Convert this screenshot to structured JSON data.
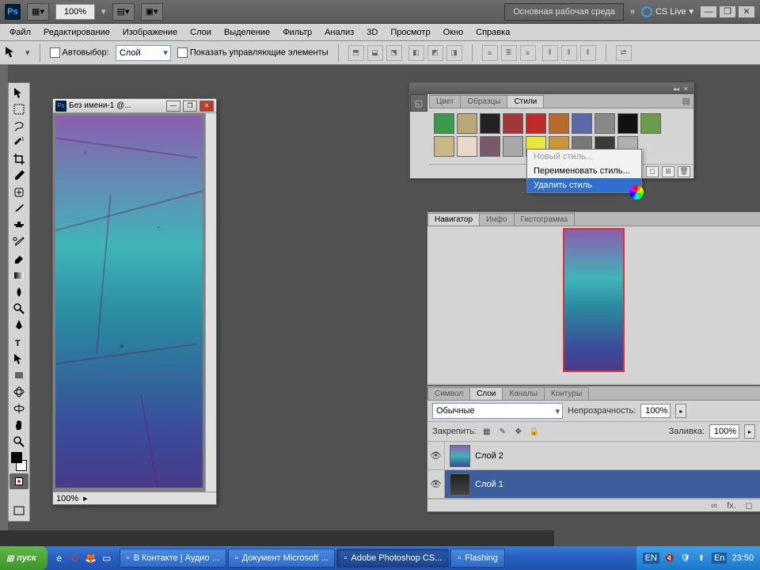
{
  "appbar": {
    "zoom": "100%",
    "workspace": "Основная рабочая среда",
    "cslive": "CS Live"
  },
  "menu": {
    "file": "Файл",
    "edit": "Редактирование",
    "image": "Изображение",
    "layer": "Слои",
    "select": "Выделение",
    "filter": "Фильтр",
    "analysis": "Анализ",
    "threeD": "3D",
    "view": "Просмотр",
    "window": "Окно",
    "help": "Справка"
  },
  "optbar": {
    "autoselect": "Автовыбор:",
    "autoselect_value": "Слой",
    "show_controls": "Показать управляющие элементы"
  },
  "docwin": {
    "title": "Без имени-1 @...",
    "status_zoom": "100%"
  },
  "styles": {
    "tab_color": "Цвет",
    "tab_swatches": "Образцы",
    "tab_styles": "Стили",
    "row1": [
      "#3a9a4a",
      "#b8a878",
      "#222222",
      "#a03838",
      "#c02a2a",
      "#b86a2a",
      "#5a6aa8",
      "#888888",
      "#111111",
      "#6a9a4a"
    ],
    "row2": [
      "#c8b888",
      "#e8d8c8",
      "#7a5a6a",
      "#a8a8a8",
      "#e8e838",
      "#c89838",
      "#787878",
      "#3a3a3a",
      "#b0b0b0"
    ]
  },
  "ctx": {
    "new": "Новый стиль...",
    "rename": "Переименовать стиль...",
    "delete": "Удалить стиль"
  },
  "nav": {
    "tab_nav": "Навигатор",
    "tab_info": "Инфо",
    "tab_hist": "Гистограмма"
  },
  "layers": {
    "tab_char": "Символ",
    "tab_layers": "Слои",
    "tab_channels": "Каналы",
    "tab_paths": "Контуры",
    "blend": "Обычные",
    "opacity_label": "Непрозрачность:",
    "opacity_val": "100%",
    "lock_label": "Закрепить:",
    "fill_label": "Заливка:",
    "fill_val": "100%",
    "layer2": "Слой 2",
    "layer1": "Слой 1"
  },
  "taskbar": {
    "start": "пуск",
    "tasks": [
      {
        "label": "В Контакте | Аудио ...",
        "active": false
      },
      {
        "label": "Документ Microsoft ...",
        "active": false
      },
      {
        "label": "Adobe Photoshop CS...",
        "active": true
      },
      {
        "label": "Flashing",
        "active": false
      }
    ],
    "lang": "EN",
    "time": "23:50"
  }
}
